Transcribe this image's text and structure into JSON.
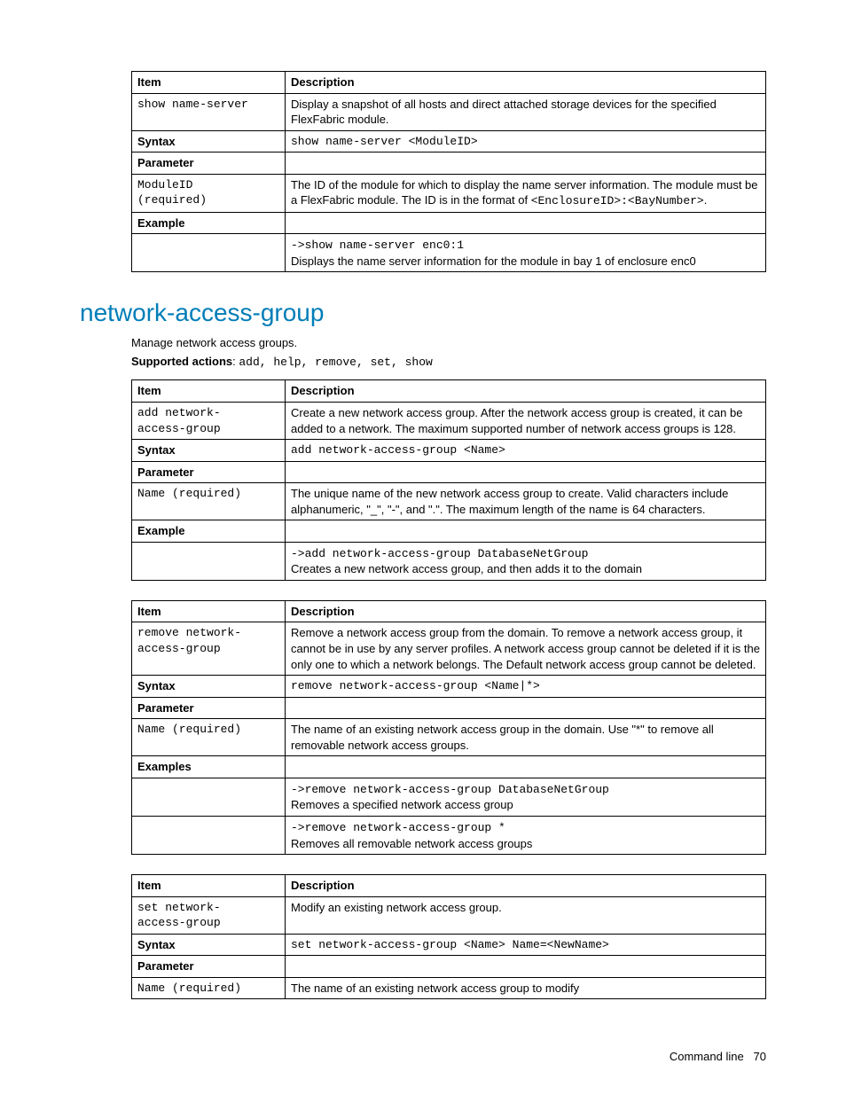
{
  "chart_data": {
    "type": "table",
    "tables": [
      {
        "name": "show name-server",
        "rows": [
          [
            "Item",
            "Description"
          ],
          [
            "show name-server",
            "Display a snapshot of all hosts and direct attached storage devices for the specified FlexFabric module."
          ],
          [
            "Syntax",
            "show name-server <ModuleID>"
          ],
          [
            "Parameter",
            ""
          ],
          [
            "ModuleID (required)",
            "The ID of the module for which to display the name server information. The module must be a FlexFabric module. The ID is in the format of <EnclosureID>:<BayNumber>."
          ],
          [
            "Example",
            ""
          ],
          [
            "",
            "->show name-server enc0:1  Displays the name server information for the module in bay 1 of enclosure enc0"
          ]
        ]
      },
      {
        "name": "add network-access-group",
        "rows": [
          [
            "Item",
            "Description"
          ],
          [
            "add network-access-group",
            "Create a new network access group. After the network access group is created, it can be added to a network. The maximum supported number of network access groups is 128."
          ],
          [
            "Syntax",
            "add network-access-group <Name>"
          ],
          [
            "Parameter",
            ""
          ],
          [
            "Name (required)",
            "The unique name of the new network access group to create. Valid characters include alphanumeric, \"_\", \"-\", and \".\". The maximum length of the name is 64 characters."
          ],
          [
            "Example",
            ""
          ],
          [
            "",
            "->add network-access-group DatabaseNetGroup  Creates a new network access group, and then adds it to the domain"
          ]
        ]
      },
      {
        "name": "remove network-access-group",
        "rows": [
          [
            "Item",
            "Description"
          ],
          [
            "remove network-access-group",
            "Remove a network access group from the domain. To remove a network access group, it cannot be in use by any server profiles. A network access group cannot be deleted if it is the only one to which a network belongs. The Default network access group cannot be deleted."
          ],
          [
            "Syntax",
            "remove network-access-group <Name|*>"
          ],
          [
            "Parameter",
            ""
          ],
          [
            "Name (required)",
            "The name of an existing network access group in the domain. Use \"*\" to remove all removable network access groups."
          ],
          [
            "Examples",
            ""
          ],
          [
            "",
            "->remove network-access-group DatabaseNetGroup  Removes a specified network access group"
          ],
          [
            "",
            "->remove network-access-group *  Removes all removable network access groups"
          ]
        ]
      },
      {
        "name": "set network-access-group",
        "rows": [
          [
            "Item",
            "Description"
          ],
          [
            "set network-access-group",
            "Modify an existing network access group."
          ],
          [
            "Syntax",
            "set network-access-group <Name> Name=<NewName>"
          ],
          [
            "Parameter",
            ""
          ],
          [
            "Name (required)",
            "The name of an existing network access group to modify"
          ]
        ]
      }
    ]
  },
  "t1": {
    "h_item": "Item",
    "h_desc": "Description",
    "r1c1": "show name-server",
    "r1c2": "Display a snapshot of all hosts and direct attached storage devices for the specified FlexFabric module.",
    "syntax_lbl": "Syntax",
    "syntax_val": "show name-server <ModuleID>",
    "param_lbl": "Parameter",
    "p1c1a": "ModuleID",
    "p1c1b": "(required)",
    "p1c2a": "The ID of the module for which to display the name server information. The module must be a FlexFabric module. The ID is in the format of ",
    "p1c2b": "<EnclosureID>:<BayNumber>",
    "p1c2c": ".",
    "example_lbl": "Example",
    "ex_cmd": "->show name-server enc0:1",
    "ex_desc": "Displays the name server information for the module in bay 1 of enclosure enc0"
  },
  "section": {
    "title": "network-access-group",
    "intro": "Manage network access groups.",
    "supported_lbl": "Supported actions",
    "supported_sep": ": ",
    "supported_val": "add, help, remove, set, show"
  },
  "t2": {
    "h_item": "Item",
    "h_desc": "Description",
    "r1c1a": "add network-",
    "r1c1b": "access-group",
    "r1c2": "Create a new network access group. After the network access group is created, it can be added to a network. The maximum supported number of network access groups is 128.",
    "syntax_lbl": "Syntax",
    "syntax_val": "add network-access-group <Name>",
    "param_lbl": "Parameter",
    "p1c1": "Name (required)",
    "p1c2": "The unique name of the new network access group to create. Valid characters include alphanumeric, \"_\", \"-\", and \".\". The maximum length of the name is 64 characters.",
    "example_lbl": "Example",
    "ex_cmd": "->add network-access-group DatabaseNetGroup",
    "ex_desc": "Creates a new network access group, and then adds it to the domain"
  },
  "t3": {
    "h_item": "Item",
    "h_desc": "Description",
    "r1c1a": "remove network-",
    "r1c1b": "access-group",
    "r1c2": "Remove a network access group from the domain. To remove a network access group, it cannot be in use by any server profiles. A network access group cannot be deleted if it is the only one to which a network belongs. The Default network access group cannot be deleted.",
    "syntax_lbl": "Syntax",
    "syntax_val": "remove network-access-group <Name|*>",
    "param_lbl": "Parameter",
    "p1c1": "Name (required)",
    "p1c2": "The name of an existing network access group in the domain. Use \"*\" to remove all removable network access groups.",
    "examples_lbl": "Examples",
    "ex1_cmd": "->remove network-access-group DatabaseNetGroup",
    "ex1_desc": "Removes a specified network access group",
    "ex2_cmd": "->remove network-access-group *",
    "ex2_desc": "Removes all removable network access groups"
  },
  "t4": {
    "h_item": "Item",
    "h_desc": "Description",
    "r1c1a": "set network-",
    "r1c1b": "access-group",
    "r1c2": "Modify an existing network access group.",
    "syntax_lbl": "Syntax",
    "syntax_val": "set network-access-group <Name> Name=<NewName>",
    "param_lbl": "Parameter",
    "p1c1": "Name (required)",
    "p1c2": "The name of an existing network access group to modify"
  },
  "footer": {
    "label": "Command line",
    "page": "70"
  }
}
